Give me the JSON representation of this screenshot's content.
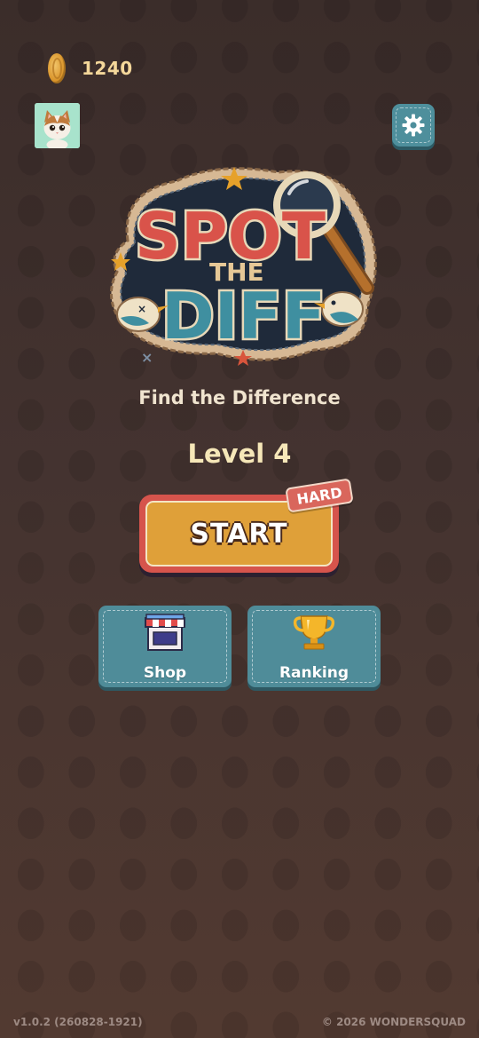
{
  "currency": {
    "icon": "coin-icon",
    "amount": "1240"
  },
  "profile": {
    "avatar": "cat-avatar"
  },
  "settings": {
    "icon": "gear-icon"
  },
  "logo": {
    "line1": "SPOT",
    "line2": "THE",
    "line3": "DIFF"
  },
  "subtitle": "Find the Difference",
  "level": {
    "label": "Level 4"
  },
  "start": {
    "label": "START",
    "badge": "HARD"
  },
  "menu": {
    "shop": {
      "label": "Shop",
      "icon": "storefront-icon"
    },
    "ranking": {
      "label": "Ranking",
      "icon": "trophy-icon"
    }
  },
  "footer": {
    "version": "v1.0.2 (260828-1921)",
    "copyright": "© 2026 WONDERSQUAD"
  },
  "colors": {
    "background": "#3e2e2b",
    "accent_teal": "#4f8c99",
    "start_orange": "#dfa039",
    "start_border": "#d6544c",
    "coin_text": "#f4d79a"
  }
}
